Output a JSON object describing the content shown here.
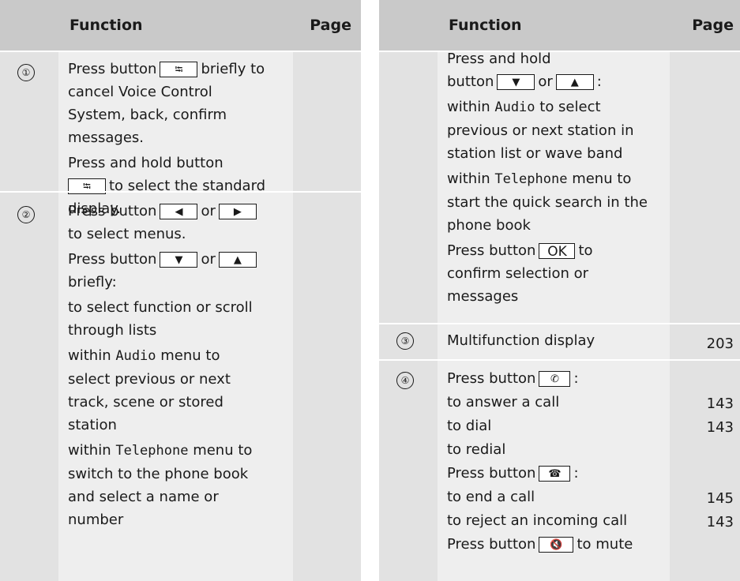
{
  "left": {
    "header": {
      "function": "Function",
      "page": "Page"
    },
    "row1": {
      "marker": "①",
      "p1a": "Press button",
      "p1b": "briefly to",
      "p1c": "cancel Voice Control",
      "p1d": "System, back, confirm",
      "p1e": "messages.",
      "p2a": "Press and hold button",
      "p2b": "to select the standard",
      "p2c": "display."
    },
    "row2": {
      "marker": "②",
      "l1": "Press button",
      "l1b": "or",
      "l2": "to select menus.",
      "l3": "Press button",
      "l3b": "or",
      "l4": "briefly:",
      "l5": "to select function or scroll",
      "l6": "through lists",
      "l7a": "within",
      "l7mono": "Audio",
      "l7b": "menu to",
      "l8": "select previous or next",
      "l9": "track, scene or stored",
      "l10": "station",
      "l11a": "within",
      "l11mono": "Telephone",
      "l11b": "menu to",
      "l12": "switch to the phone book",
      "l13": "and select a name or",
      "l14": "number"
    }
  },
  "right": {
    "header": {
      "function": "Function",
      "page": "Page"
    },
    "cont": {
      "l1": "Press and hold",
      "l2a": "button",
      "l2b": "or",
      "l2c": ":",
      "l3a": "within",
      "l3mono": "Audio",
      "l3b": "to select",
      "l4": "previous or next station in",
      "l5": "station list or wave band",
      "l6a": "within",
      "l6mono": "Telephone",
      "l6b": "menu to",
      "l7": "start the quick search in the",
      "l8": "phone book",
      "l9a": "Press button",
      "l9b": "to",
      "l10": "confirm selection or",
      "l11": "messages",
      "ok": "OK"
    },
    "row3": {
      "marker": "③",
      "text": "Multifunction display",
      "page": "203"
    },
    "row4": {
      "marker": "④",
      "l1a": "Press button",
      "l1b": ":",
      "l2": "to answer a call",
      "p2": "143",
      "l3": "to dial",
      "p3": "143",
      "l4": "to redial",
      "l5a": "Press button",
      "l5b": ":",
      "l6": "to end a call",
      "p6": "145",
      "l7": "to reject an incoming call",
      "p7": "143",
      "l8a": "Press button",
      "l8b": "to mute"
    }
  }
}
